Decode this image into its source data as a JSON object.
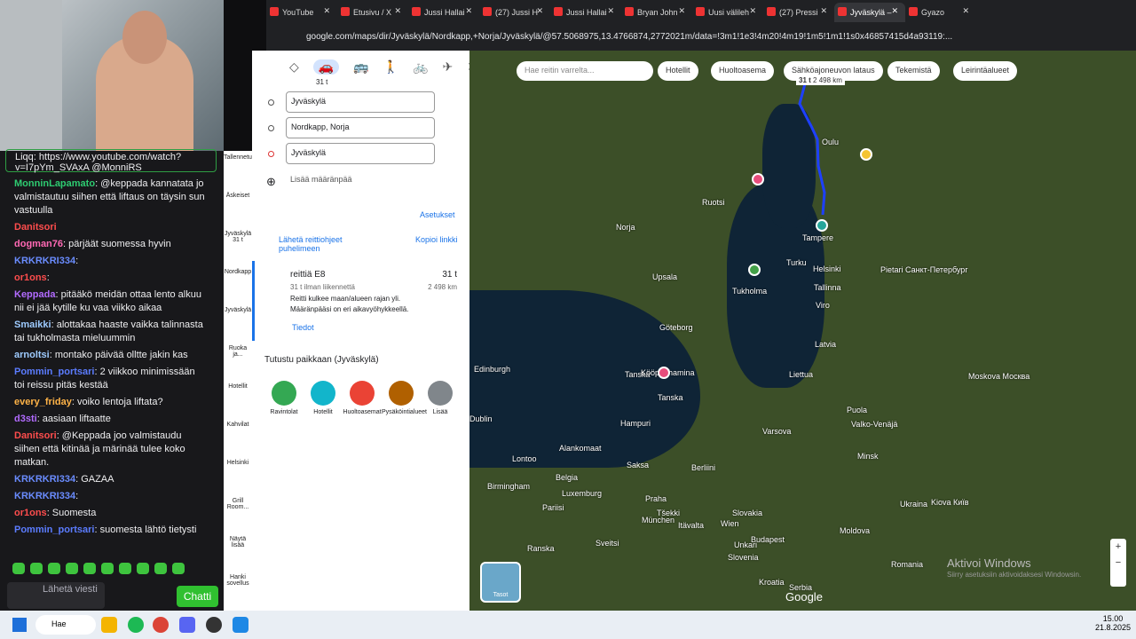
{
  "chat": {
    "link_text": "Liqq: https://www.youtube.com/watch?v=I7pYm_SVAxA @MonniRS",
    "messages": [
      {
        "user": "MonninLapamato",
        "text": ": @keppada kannatata jo valmistautuu siihen että liftaus on täysin sun vastuulla",
        "color": "#2ecc71"
      },
      {
        "user": "Danitsori",
        "text": "",
        "color": "#ff4d4d"
      },
      {
        "user": "dogman76",
        "text": ": pärjäät suomessa hyvin",
        "color": "#ff69b4"
      },
      {
        "user": "KRKRKRI334",
        "text": ":",
        "color": "#6a8cff"
      },
      {
        "user": "or1ons",
        "text": ":",
        "color": "#ff4d4d"
      },
      {
        "user": "Keppada",
        "text": ": pitääkö meidän ottaa lento alkuu nii ei jää kytille ku vaa viikko aikaa",
        "color": "#b26bff"
      },
      {
        "user": "Smaikki",
        "text": ": alottakaa haaste vaikka talinnasta tai tukholmasta mieluummin",
        "color": "#9ecbff"
      },
      {
        "user": "arnoltsi",
        "text": ": montako päivää olltte jakin kas",
        "color": "#9ecbff"
      },
      {
        "user": "Pommin_portsari",
        "text": ": 2 viikkoo minimissään toi reissu pitäs kestää",
        "color": "#5b7cff"
      },
      {
        "user": "every_friday",
        "text": ": voiko lentoja liftata?",
        "color": "#ffb347"
      },
      {
        "user": "d3sti",
        "text": ": aasiaan liftaatte",
        "color": "#b26bff"
      },
      {
        "user": "Danitsori",
        "text": ": @Keppada joo valmistaudu siihen että kitinää ja märinää tulee koko matkan.",
        "color": "#ff4d4d"
      },
      {
        "user": "KRKRKRI334",
        "text": ": GAZAA",
        "color": "#6a8cff"
      },
      {
        "user": "KRKRKRI334",
        "text": ":",
        "color": "#6a8cff"
      },
      {
        "user": "or1ons",
        "text": ": Suomesta",
        "color": "#ff4d4d"
      },
      {
        "user": "Pommin_portsari",
        "text": ": suomesta lähtö tietysti",
        "color": "#5b7cff"
      }
    ],
    "input_placeholder": "Lähetä viesti",
    "chat_button": "Chatti"
  },
  "sidebar": [
    "Tallennetut",
    "Äskeiset",
    "Jyväskylä 31 t",
    "Nordkapp",
    "Jyväskylä",
    "Ruoka ja...",
    "Hotellit",
    "Kahvilat",
    "Helsinki",
    "Grill Room...",
    "Näytä lisää",
    "Hanki sovellus"
  ],
  "browser": {
    "tabs": [
      "YouTube",
      "Etusivu / X",
      "Jussi Hallai",
      "(27) Jussi H",
      "Jussi Hallai",
      "Bryan John",
      "Uusi välileh",
      "(27) Pressi",
      "Jyväskylä –",
      "Gyazo"
    ],
    "url": "google.com/maps/dir/Jyväskylä/Nordkapp,+Norja/Jyväskylä/@57.5068975,13.4766874,2772021m/data=!3m1!1e3!4m20!4m19!1m5!1m1!1s0x46857415d4a93119:..."
  },
  "panel": {
    "mode_time": "31 t",
    "stops": [
      "Jyväskylä",
      "Nordkapp, Norja",
      "Jyväskylä"
    ],
    "add_destination": "Lisää määränpää",
    "settings": "Asetukset",
    "send_phone": "Lähetä reittiohjeet puhelimeen",
    "copy_link": "Kopioi linkki",
    "route_name": "reittiä E8",
    "route_time": "31 t",
    "route_sub": "31 t ilman liikennettä",
    "route_dist": "2 498 km",
    "warn1": "Reitti kulkee maan/alueen rajan yli.",
    "warn2": "Määränpääsi on eri aikavyöhykkeellä.",
    "details": "Tiedot",
    "explore": "Tutustu paikkaan (Jyväskylä)",
    "categories": [
      "Ravintolat",
      "Hotellit",
      "Huoltoasemat",
      "Pysäköintialueet",
      "Lisää"
    ]
  },
  "map": {
    "search_placeholder": "Hae reitin varrelta...",
    "chips": [
      "Hotellit",
      "Huoltoasema",
      "Sähköajoneuvon lataus",
      "Tekemistä",
      "Leirintäalueet"
    ],
    "route_time": "31 t",
    "route_dist": "2 498 km",
    "layers": "Tasot",
    "google": "Google",
    "watermark1": "Aktivoi Windows",
    "watermark2": "Siirry asetuksiin aktivoidaksesi Windowsin.",
    "labels": [
      "Oulu",
      "Ruotsi",
      "Norja",
      "Tampere",
      "Turku",
      "Helsinki",
      "Pietari Санкт-Петербург",
      "Upsala",
      "Tukholma",
      "Tallinna",
      "Viro",
      "Göteborg",
      "Latvia",
      "Liettua",
      "Tanska",
      "Kööpenhamina",
      "Moskova Москва",
      "Edinburgh",
      "Dublin",
      "Valko-Venäjä",
      "Puola",
      "Birmingham",
      "Lontoo",
      "Alankomaat",
      "Saksa",
      "Belgia",
      "Luxemburg",
      "Pariisi",
      "Praha",
      "Tšekki",
      "Ukraina",
      "Slovakia",
      "München",
      "Wien",
      "Itävalta",
      "Budapest",
      "Sveitsi",
      "Moldova",
      "Ranska",
      "Kiova Київ",
      "Slovenia",
      "Unkari",
      "Romania",
      "Kroatia",
      "Serbia",
      "Minsk",
      "Varsova",
      "Berliini",
      "Hampuri",
      "Tanska"
    ]
  },
  "taskbar": {
    "search": "Hae",
    "time": "15.00",
    "date": "21.8.2025"
  }
}
